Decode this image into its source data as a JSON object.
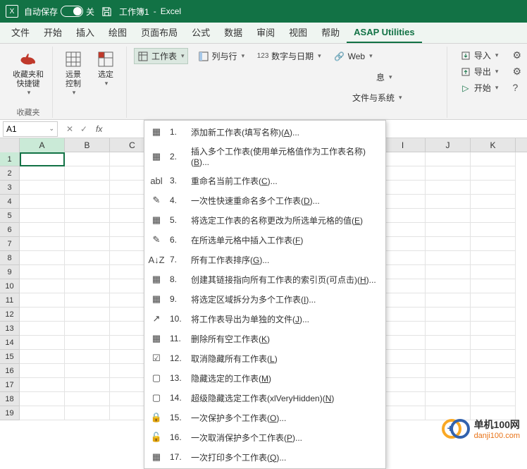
{
  "titlebar": {
    "autosave_label": "自动保存",
    "autosave_state": "关",
    "doc_name": "工作簿1",
    "app_name": "Excel"
  },
  "tabs": [
    "文件",
    "开始",
    "插入",
    "绘图",
    "页面布局",
    "公式",
    "数据",
    "审阅",
    "视图",
    "帮助",
    "ASAP Utilities"
  ],
  "active_tab": "ASAP Utilities",
  "ribbon": {
    "fav_group": "收藏夹",
    "fav_btn": "收藏夹和\n快捷键",
    "vision_btn": "远景\n控制",
    "select_btn": "选定",
    "worksheet_btn": "工作表",
    "colrow_btn": "列与行",
    "numdate_btn": "数字与日期",
    "web_btn": "Web",
    "info_btn": "息",
    "filesys_btn": "文件与系统",
    "import_btn": "导入",
    "export_btn": "导出",
    "start_btn": "开始"
  },
  "formula": {
    "cell_ref": "A1"
  },
  "columns": [
    "A",
    "B",
    "C",
    "",
    "",
    "",
    "",
    "",
    "I",
    "J",
    "K"
  ],
  "rows": [
    1,
    2,
    3,
    4,
    5,
    6,
    7,
    8,
    9,
    10,
    11,
    12,
    13,
    14,
    15,
    16,
    17,
    18,
    19
  ],
  "menu": [
    {
      "num": "1.",
      "txt": "添加新工作表(填写名称)(A)..."
    },
    {
      "num": "2.",
      "txt": "插入多个工作表(使用单元格值作为工作表名称)(B)..."
    },
    {
      "num": "3.",
      "txt": "重命名当前工作表(C)..."
    },
    {
      "num": "4.",
      "txt": "一次性快速重命名多个工作表(D)..."
    },
    {
      "num": "5.",
      "txt": "将选定工作表的名称更改为所选单元格的值(E)"
    },
    {
      "num": "6.",
      "txt": "在所选单元格中插入工作表(F)"
    },
    {
      "num": "7.",
      "txt": "所有工作表排序(G)..."
    },
    {
      "num": "8.",
      "txt": "创建其链接指向所有工作表的索引页(可点击)(H)..."
    },
    {
      "num": "9.",
      "txt": "将选定区域拆分为多个工作表(I)..."
    },
    {
      "num": "10.",
      "txt": "将工作表导出为单独的文件(J)..."
    },
    {
      "num": "11.",
      "txt": "删除所有空工作表(K)"
    },
    {
      "num": "12.",
      "txt": "取消隐藏所有工作表(L)"
    },
    {
      "num": "13.",
      "txt": "隐藏选定的工作表(M)"
    },
    {
      "num": "14.",
      "txt": "超级隐藏选定工作表(xlVeryHidden)(N)"
    },
    {
      "num": "15.",
      "txt": "一次保护多个工作表(O)..."
    },
    {
      "num": "16.",
      "txt": "一次取消保护多个工作表(P)..."
    },
    {
      "num": "17.",
      "txt": "一次打印多个工作表(Q)..."
    }
  ],
  "watermark": {
    "name": "单机100网",
    "url": "danji100.com"
  }
}
